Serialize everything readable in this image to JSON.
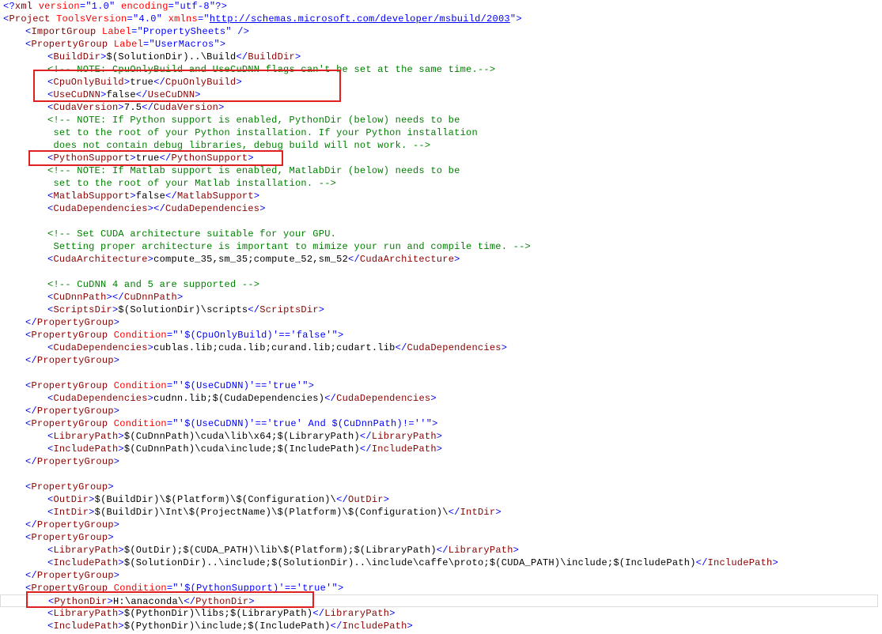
{
  "editor": {
    "lines": [
      {
        "indent": 0,
        "tokens": [
          [
            "p",
            "<?"
          ],
          [
            "t",
            "xml"
          ],
          [
            "a",
            " version"
          ],
          [
            "p",
            "="
          ],
          [
            "v",
            "\"1.0\""
          ],
          [
            "a",
            " encoding"
          ],
          [
            "p",
            "="
          ],
          [
            "v",
            "\"utf-8\""
          ],
          [
            "p",
            "?>"
          ]
        ]
      },
      {
        "indent": 0,
        "tokens": [
          [
            "p",
            "<"
          ],
          [
            "t",
            "Project"
          ],
          [
            "a",
            " ToolsVersion"
          ],
          [
            "p",
            "="
          ],
          [
            "v",
            "\"4.0\""
          ],
          [
            "a",
            " xmlns"
          ],
          [
            "p",
            "="
          ],
          [
            "p",
            "\""
          ],
          [
            "u",
            "http://schemas.microsoft.com/developer/msbuild/2003"
          ],
          [
            "p",
            "\""
          ],
          [
            "p",
            ">"
          ]
        ]
      },
      {
        "indent": 1,
        "tokens": [
          [
            "p",
            "<"
          ],
          [
            "t",
            "ImportGroup"
          ],
          [
            "a",
            " Label"
          ],
          [
            "p",
            "="
          ],
          [
            "v",
            "\"PropertySheets\""
          ],
          [
            "p",
            " />"
          ]
        ]
      },
      {
        "indent": 1,
        "tokens": [
          [
            "p",
            "<"
          ],
          [
            "t",
            "PropertyGroup"
          ],
          [
            "a",
            " Label"
          ],
          [
            "p",
            "="
          ],
          [
            "v",
            "\"UserMacros\""
          ],
          [
            "p",
            ">"
          ]
        ]
      },
      {
        "indent": 2,
        "tokens": [
          [
            "p",
            "<"
          ],
          [
            "t",
            "BuildDir"
          ],
          [
            "p",
            ">"
          ],
          [
            "x",
            "$(SolutionDir)..\\Build"
          ],
          [
            "p",
            "</"
          ],
          [
            "t",
            "BuildDir"
          ],
          [
            "p",
            ">"
          ]
        ]
      },
      {
        "indent": 2,
        "tokens": [
          [
            "c",
            "<!-- NOTE: CpuOnlyBuild and UseCuDNN flags can't be set at the same time.-->"
          ]
        ]
      },
      {
        "indent": 2,
        "tokens": [
          [
            "p",
            "<"
          ],
          [
            "t",
            "CpuOnlyBuild"
          ],
          [
            "p",
            ">"
          ],
          [
            "x",
            "true"
          ],
          [
            "p",
            "</"
          ],
          [
            "t",
            "CpuOnlyBuild"
          ],
          [
            "p",
            ">"
          ]
        ]
      },
      {
        "indent": 2,
        "tokens": [
          [
            "p",
            "<"
          ],
          [
            "t",
            "UseCuDNN"
          ],
          [
            "p",
            ">"
          ],
          [
            "x",
            "false"
          ],
          [
            "p",
            "</"
          ],
          [
            "t",
            "UseCuDNN"
          ],
          [
            "p",
            ">"
          ]
        ]
      },
      {
        "indent": 2,
        "tokens": [
          [
            "p",
            "<"
          ],
          [
            "t",
            "CudaVersion"
          ],
          [
            "p",
            ">"
          ],
          [
            "x",
            "7.5"
          ],
          [
            "p",
            "</"
          ],
          [
            "t",
            "CudaVersion"
          ],
          [
            "p",
            ">"
          ]
        ]
      },
      {
        "indent": 2,
        "tokens": [
          [
            "c",
            "<!-- NOTE: If Python support is enabled, PythonDir (below) needs to be"
          ]
        ]
      },
      {
        "indent": 2,
        "tokens": [
          [
            "c",
            " set to the root of your Python installation. If your Python installation"
          ]
        ]
      },
      {
        "indent": 2,
        "tokens": [
          [
            "c",
            " does not contain debug libraries, debug build will not work. -->"
          ]
        ]
      },
      {
        "indent": 2,
        "tokens": [
          [
            "p",
            "<"
          ],
          [
            "t",
            "PythonSupport"
          ],
          [
            "p",
            ">"
          ],
          [
            "x",
            "true"
          ],
          [
            "p",
            "</"
          ],
          [
            "t",
            "PythonSupport"
          ],
          [
            "p",
            ">"
          ]
        ]
      },
      {
        "indent": 2,
        "tokens": [
          [
            "c",
            "<!-- NOTE: If Matlab support is enabled, MatlabDir (below) needs to be"
          ]
        ]
      },
      {
        "indent": 2,
        "tokens": [
          [
            "c",
            " set to the root of your Matlab installation. -->"
          ]
        ]
      },
      {
        "indent": 2,
        "tokens": [
          [
            "p",
            "<"
          ],
          [
            "t",
            "MatlabSupport"
          ],
          [
            "p",
            ">"
          ],
          [
            "x",
            "false"
          ],
          [
            "p",
            "</"
          ],
          [
            "t",
            "MatlabSupport"
          ],
          [
            "p",
            ">"
          ]
        ]
      },
      {
        "indent": 2,
        "tokens": [
          [
            "p",
            "<"
          ],
          [
            "t",
            "CudaDependencies"
          ],
          [
            "p",
            "></"
          ],
          [
            "t",
            "CudaDependencies"
          ],
          [
            "p",
            ">"
          ]
        ]
      },
      {
        "indent": 0,
        "tokens": []
      },
      {
        "indent": 2,
        "tokens": [
          [
            "c",
            "<!-- Set CUDA architecture suitable for your GPU."
          ]
        ]
      },
      {
        "indent": 2,
        "tokens": [
          [
            "c",
            " Setting proper architecture is important to mimize your run and compile time. -->"
          ]
        ]
      },
      {
        "indent": 2,
        "tokens": [
          [
            "p",
            "<"
          ],
          [
            "t",
            "CudaArchitecture"
          ],
          [
            "p",
            ">"
          ],
          [
            "x",
            "compute_35,sm_35;compute_52,sm_52"
          ],
          [
            "p",
            "</"
          ],
          [
            "t",
            "CudaArchitecture"
          ],
          [
            "p",
            ">"
          ]
        ]
      },
      {
        "indent": 0,
        "tokens": []
      },
      {
        "indent": 2,
        "tokens": [
          [
            "c",
            "<!-- CuDNN 4 and 5 are supported -->"
          ]
        ]
      },
      {
        "indent": 2,
        "tokens": [
          [
            "p",
            "<"
          ],
          [
            "t",
            "CuDnnPath"
          ],
          [
            "p",
            "></"
          ],
          [
            "t",
            "CuDnnPath"
          ],
          [
            "p",
            ">"
          ]
        ]
      },
      {
        "indent": 2,
        "tokens": [
          [
            "p",
            "<"
          ],
          [
            "t",
            "ScriptsDir"
          ],
          [
            "p",
            ">"
          ],
          [
            "x",
            "$(SolutionDir)\\scripts"
          ],
          [
            "p",
            "</"
          ],
          [
            "t",
            "ScriptsDir"
          ],
          [
            "p",
            ">"
          ]
        ]
      },
      {
        "indent": 1,
        "tokens": [
          [
            "p",
            "</"
          ],
          [
            "t",
            "PropertyGroup"
          ],
          [
            "p",
            ">"
          ]
        ]
      },
      {
        "indent": 1,
        "tokens": [
          [
            "p",
            "<"
          ],
          [
            "t",
            "PropertyGroup"
          ],
          [
            "a",
            " Condition"
          ],
          [
            "p",
            "="
          ],
          [
            "v",
            "\"'$(CpuOnlyBuild)'=='false'\""
          ],
          [
            "p",
            ">"
          ]
        ]
      },
      {
        "indent": 2,
        "tokens": [
          [
            "p",
            "<"
          ],
          [
            "t",
            "CudaDependencies"
          ],
          [
            "p",
            ">"
          ],
          [
            "x",
            "cublas.lib;cuda.lib;curand.lib;cudart.lib"
          ],
          [
            "p",
            "</"
          ],
          [
            "t",
            "CudaDependencies"
          ],
          [
            "p",
            ">"
          ]
        ]
      },
      {
        "indent": 1,
        "tokens": [
          [
            "p",
            "</"
          ],
          [
            "t",
            "PropertyGroup"
          ],
          [
            "p",
            ">"
          ]
        ]
      },
      {
        "indent": 0,
        "tokens": []
      },
      {
        "indent": 1,
        "tokens": [
          [
            "p",
            "<"
          ],
          [
            "t",
            "PropertyGroup"
          ],
          [
            "a",
            " Condition"
          ],
          [
            "p",
            "="
          ],
          [
            "v",
            "\"'$(UseCuDNN)'=='true'\""
          ],
          [
            "p",
            ">"
          ]
        ]
      },
      {
        "indent": 2,
        "tokens": [
          [
            "p",
            "<"
          ],
          [
            "t",
            "CudaDependencies"
          ],
          [
            "p",
            ">"
          ],
          [
            "x",
            "cudnn.lib;$(CudaDependencies)"
          ],
          [
            "p",
            "</"
          ],
          [
            "t",
            "CudaDependencies"
          ],
          [
            "p",
            ">"
          ]
        ]
      },
      {
        "indent": 1,
        "tokens": [
          [
            "p",
            "</"
          ],
          [
            "t",
            "PropertyGroup"
          ],
          [
            "p",
            ">"
          ]
        ]
      },
      {
        "indent": 1,
        "tokens": [
          [
            "p",
            "<"
          ],
          [
            "t",
            "PropertyGroup"
          ],
          [
            "a",
            " Condition"
          ],
          [
            "p",
            "="
          ],
          [
            "v",
            "\"'$(UseCuDNN)'=='true' And $(CuDnnPath)!=''\""
          ],
          [
            "p",
            ">"
          ]
        ]
      },
      {
        "indent": 2,
        "tokens": [
          [
            "p",
            "<"
          ],
          [
            "t",
            "LibraryPath"
          ],
          [
            "p",
            ">"
          ],
          [
            "x",
            "$(CuDnnPath)\\cuda\\lib\\x64;$(LibraryPath)"
          ],
          [
            "p",
            "</"
          ],
          [
            "t",
            "LibraryPath"
          ],
          [
            "p",
            ">"
          ]
        ]
      },
      {
        "indent": 2,
        "tokens": [
          [
            "p",
            "<"
          ],
          [
            "t",
            "IncludePath"
          ],
          [
            "p",
            ">"
          ],
          [
            "x",
            "$(CuDnnPath)\\cuda\\include;$(IncludePath)"
          ],
          [
            "p",
            "</"
          ],
          [
            "t",
            "IncludePath"
          ],
          [
            "p",
            ">"
          ]
        ]
      },
      {
        "indent": 1,
        "tokens": [
          [
            "p",
            "</"
          ],
          [
            "t",
            "PropertyGroup"
          ],
          [
            "p",
            ">"
          ]
        ]
      },
      {
        "indent": 0,
        "tokens": []
      },
      {
        "indent": 1,
        "tokens": [
          [
            "p",
            "<"
          ],
          [
            "t",
            "PropertyGroup"
          ],
          [
            "p",
            ">"
          ]
        ]
      },
      {
        "indent": 2,
        "tokens": [
          [
            "p",
            "<"
          ],
          [
            "t",
            "OutDir"
          ],
          [
            "p",
            ">"
          ],
          [
            "x",
            "$(BuildDir)\\$(Platform)\\$(Configuration)\\"
          ],
          [
            "p",
            "</"
          ],
          [
            "t",
            "OutDir"
          ],
          [
            "p",
            ">"
          ]
        ]
      },
      {
        "indent": 2,
        "tokens": [
          [
            "p",
            "<"
          ],
          [
            "t",
            "IntDir"
          ],
          [
            "p",
            ">"
          ],
          [
            "x",
            "$(BuildDir)\\Int\\$(ProjectName)\\$(Platform)\\$(Configuration)\\"
          ],
          [
            "p",
            "</"
          ],
          [
            "t",
            "IntDir"
          ],
          [
            "p",
            ">"
          ]
        ]
      },
      {
        "indent": 1,
        "tokens": [
          [
            "p",
            "</"
          ],
          [
            "t",
            "PropertyGroup"
          ],
          [
            "p",
            ">"
          ]
        ]
      },
      {
        "indent": 1,
        "tokens": [
          [
            "p",
            "<"
          ],
          [
            "t",
            "PropertyGroup"
          ],
          [
            "p",
            ">"
          ]
        ]
      },
      {
        "indent": 2,
        "tokens": [
          [
            "p",
            "<"
          ],
          [
            "t",
            "LibraryPath"
          ],
          [
            "p",
            ">"
          ],
          [
            "x",
            "$(OutDir);$(CUDA_PATH)\\lib\\$(Platform);$(LibraryPath)"
          ],
          [
            "p",
            "</"
          ],
          [
            "t",
            "LibraryPath"
          ],
          [
            "p",
            ">"
          ]
        ]
      },
      {
        "indent": 2,
        "tokens": [
          [
            "p",
            "<"
          ],
          [
            "t",
            "IncludePath"
          ],
          [
            "p",
            ">"
          ],
          [
            "x",
            "$(SolutionDir)..\\include;$(SolutionDir)..\\include\\caffe\\proto;$(CUDA_PATH)\\include;$(IncludePath)"
          ],
          [
            "p",
            "</"
          ],
          [
            "t",
            "IncludePath"
          ],
          [
            "p",
            ">"
          ]
        ]
      },
      {
        "indent": 1,
        "tokens": [
          [
            "p",
            "</"
          ],
          [
            "t",
            "PropertyGroup"
          ],
          [
            "p",
            ">"
          ]
        ]
      },
      {
        "indent": 1,
        "tokens": [
          [
            "p",
            "<"
          ],
          [
            "t",
            "PropertyGroup"
          ],
          [
            "a",
            " Condition"
          ],
          [
            "p",
            "="
          ],
          [
            "v",
            "\"'$(PythonSupport)'=='true'\""
          ],
          [
            "p",
            ">"
          ]
        ]
      },
      {
        "indent": 2,
        "current": true,
        "tokens": [
          [
            "p",
            "<"
          ],
          [
            "t",
            "PythonDir"
          ],
          [
            "p",
            ">"
          ],
          [
            "x",
            "H:\\anaconda\\"
          ],
          [
            "p",
            "</"
          ],
          [
            "t",
            "PythonDir"
          ],
          [
            "p",
            ">"
          ]
        ]
      },
      {
        "indent": 2,
        "tokens": [
          [
            "p",
            "<"
          ],
          [
            "t",
            "LibraryPath"
          ],
          [
            "p",
            ">"
          ],
          [
            "x",
            "$(PythonDir)\\libs;$(LibraryPath)"
          ],
          [
            "p",
            "</"
          ],
          [
            "t",
            "LibraryPath"
          ],
          [
            "p",
            ">"
          ]
        ]
      },
      {
        "indent": 2,
        "tokens": [
          [
            "p",
            "<"
          ],
          [
            "t",
            "IncludePath"
          ],
          [
            "p",
            ">"
          ],
          [
            "x",
            "$(PythonDir)\\include;$(IncludePath)"
          ],
          [
            "p",
            "</"
          ],
          [
            "t",
            "IncludePath"
          ],
          [
            "p",
            ">"
          ]
        ]
      }
    ]
  },
  "highlights": [
    {
      "name": "highlight-cpuonly-cudnn",
      "color": "#e02020"
    },
    {
      "name": "highlight-pythonsupport",
      "color": "#e02020"
    },
    {
      "name": "highlight-pythondir",
      "color": "#e02020"
    }
  ]
}
